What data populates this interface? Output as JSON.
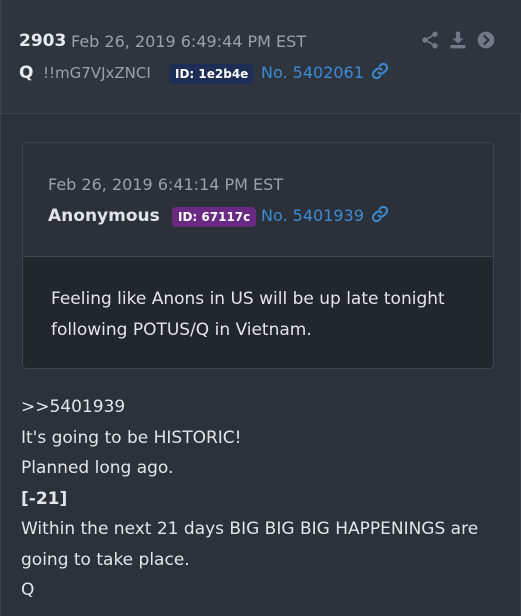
{
  "post": {
    "number": "2903",
    "date": "Feb 26, 2019 6:49:44 PM EST",
    "author": "Q",
    "tripcode": "!!mG7VJxZNCI",
    "id_label": "ID: 1e2b4e",
    "no_label": "No. 5402061",
    "icons": [
      "share-icon",
      "download-icon",
      "next-arrow-icon"
    ],
    "colors": {
      "link": "#3b8bd6",
      "id_main_bg": "#1d2d54",
      "id_quote_bg": "#6a2a84"
    }
  },
  "quote": {
    "date": "Feb 26, 2019 6:41:14 PM EST",
    "author": "Anonymous",
    "id_label": "ID: 67117c",
    "no_label": "No. 5401939",
    "text_line1": "Feeling like Anons in US will be up late tonight",
    "text_line2": "following POTUS/Q in Vietnam."
  },
  "body": {
    "lines": [
      ">>5401939",
      "It's going to be HISTORIC!",
      "Planned long ago.",
      "[-21]",
      "Within the next 21 days BIG BIG BIG HAPPENINGS are",
      "going to take place.",
      "Q"
    ]
  }
}
